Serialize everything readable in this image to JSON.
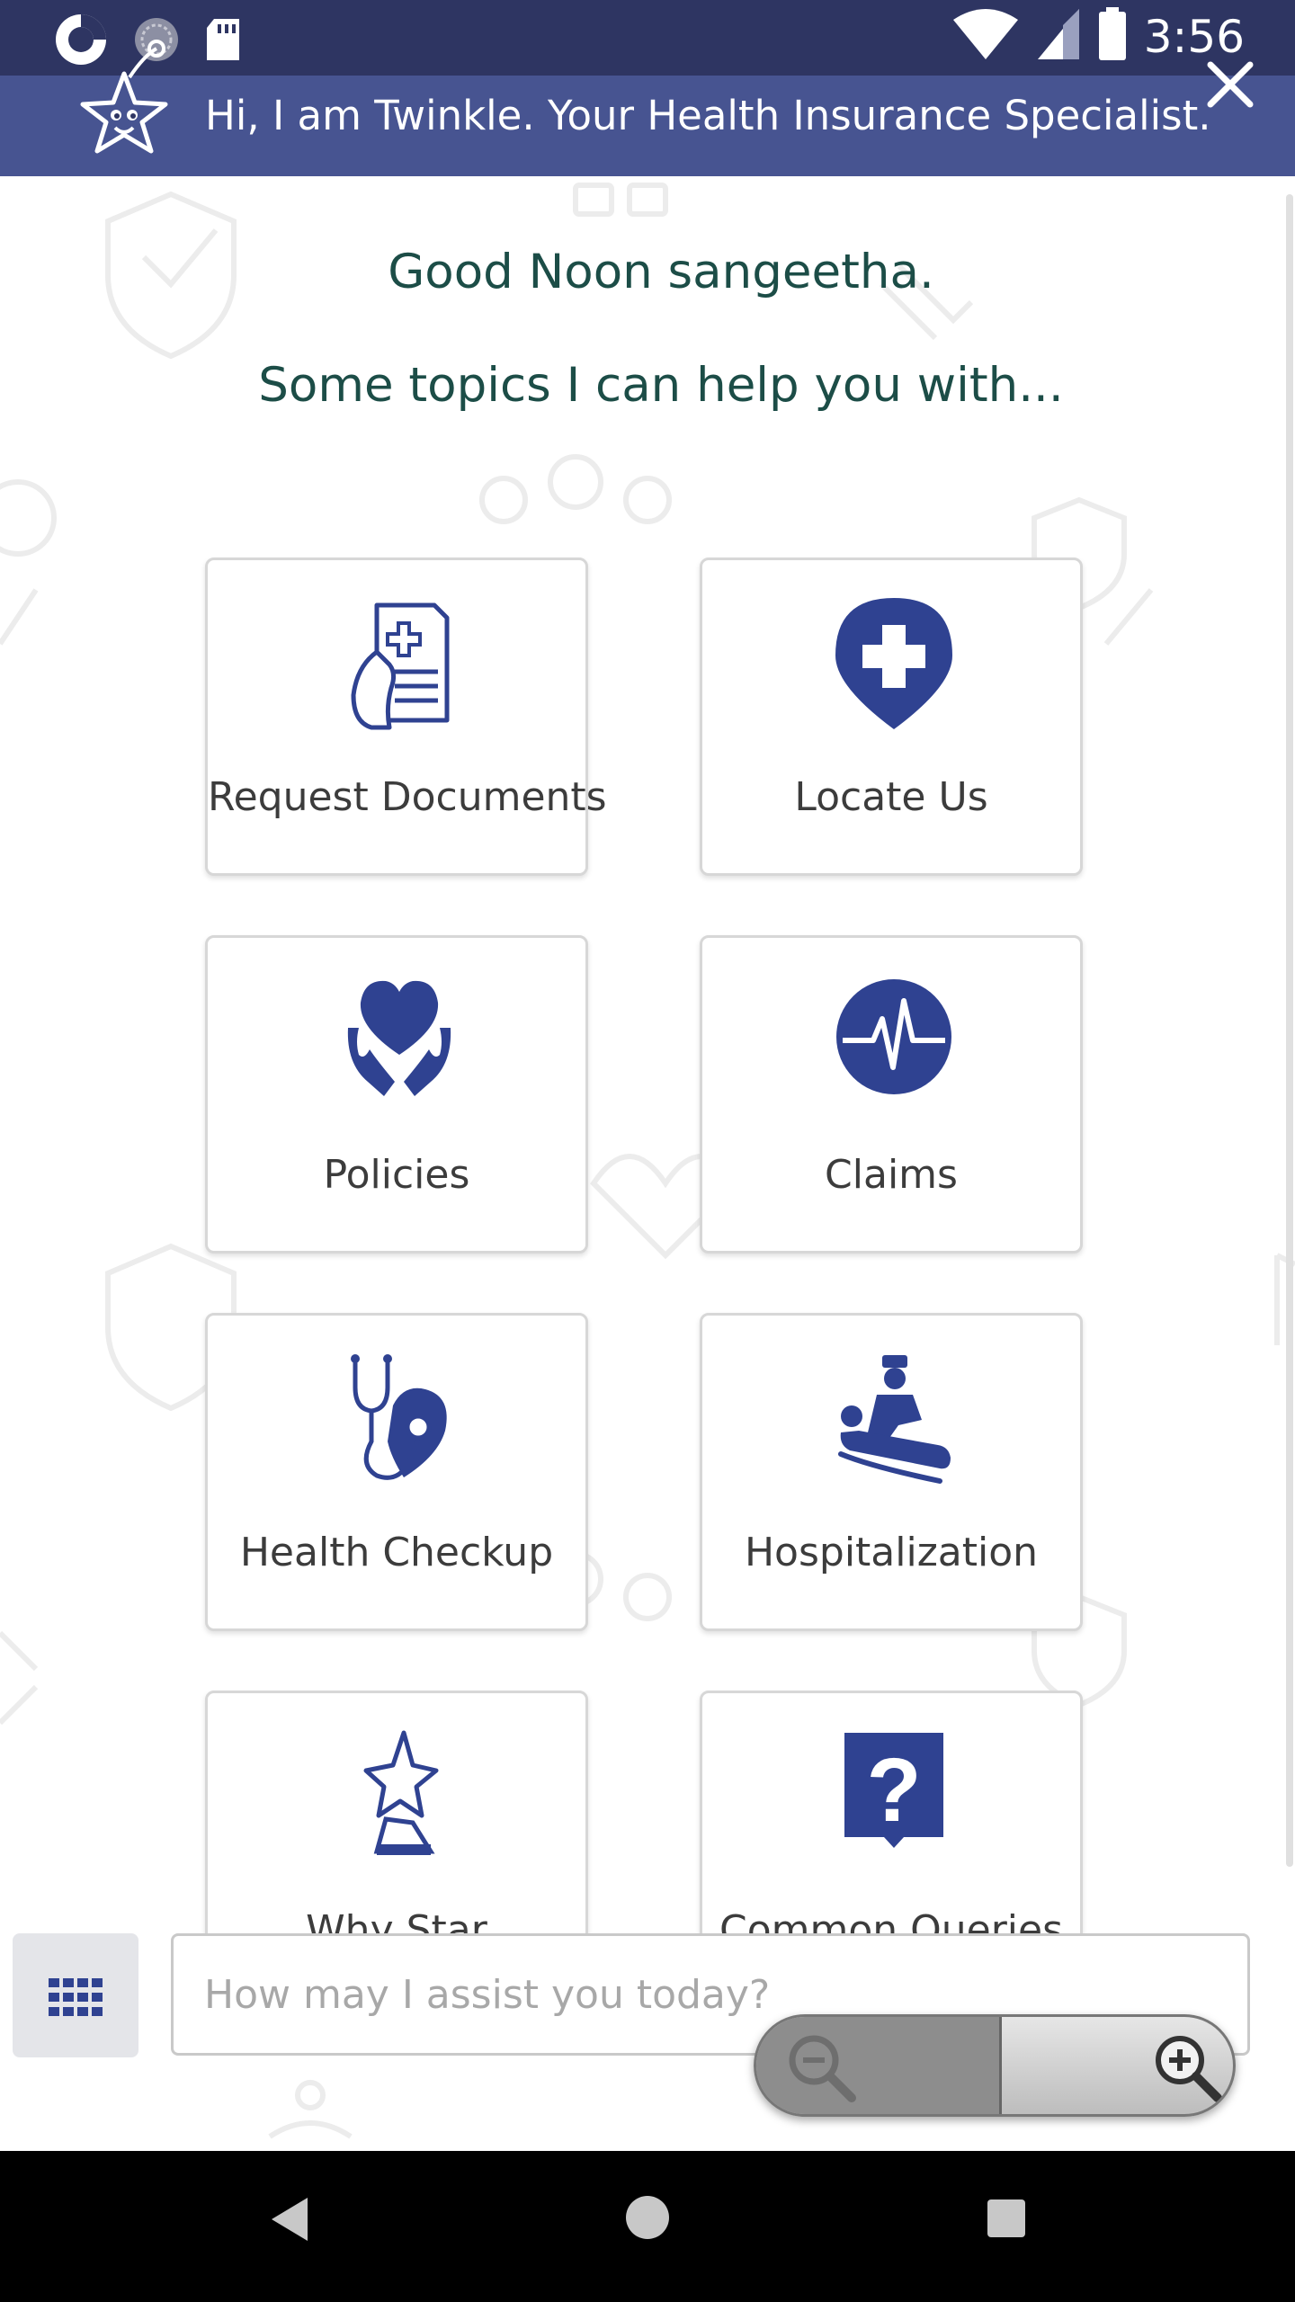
{
  "status_bar": {
    "time": "3:56",
    "left_icons": [
      "sync-icon",
      "music-icon",
      "sd-card-icon"
    ],
    "right_icons": [
      "wifi-icon",
      "signal-icon",
      "battery-icon"
    ]
  },
  "header": {
    "title": "Hi, I am Twinkle. Your Health Insurance Specialist.",
    "mascot_icon": "star-mascot-icon",
    "close_icon": "close-icon",
    "background": "#475491"
  },
  "main": {
    "greeting": "Good Noon sangeetha.",
    "subgreeting": "Some topics I can help you with...",
    "accent_color": "#2f4291",
    "topics": [
      {
        "label": "Request Documents",
        "icon": "document-icon"
      },
      {
        "label": "Locate Us",
        "icon": "location-pin-icon"
      },
      {
        "label": "Policies",
        "icon": "hands-heart-icon"
      },
      {
        "label": "Claims",
        "icon": "heartbeat-icon"
      },
      {
        "label": "Health Checkup",
        "icon": "stethoscope-icon"
      },
      {
        "label": "Hospitalization",
        "icon": "hospital-bed-icon"
      },
      {
        "label": "Why Star",
        "icon": "star-trophy-icon"
      },
      {
        "label": "Common Queries",
        "icon": "question-icon"
      }
    ]
  },
  "chat": {
    "placeholder": "How may I assist you today?",
    "menu_icon": "grid-menu-icon"
  },
  "zoom": {
    "out_icon": "zoom-out-icon",
    "in_icon": "zoom-in-icon"
  },
  "nav_bar": {
    "icons": [
      "back-icon",
      "home-icon",
      "recents-icon"
    ]
  }
}
